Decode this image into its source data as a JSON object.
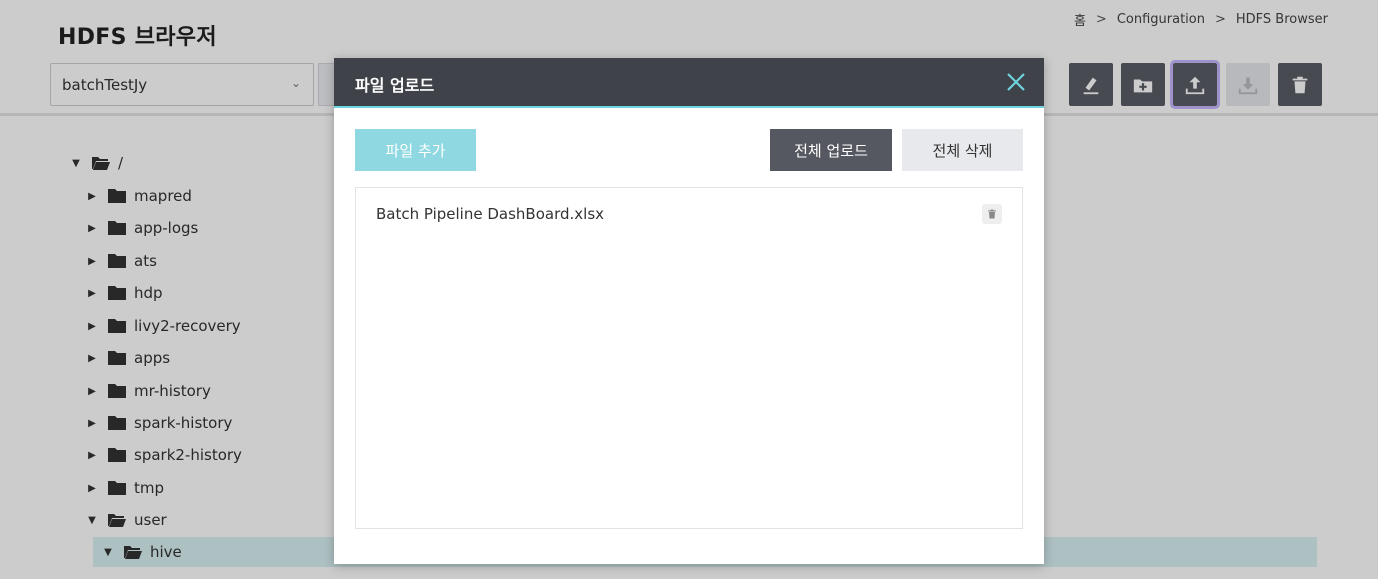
{
  "header": {
    "title": "HDFS 브라우저",
    "breadcrumb": [
      "홈",
      "Configuration",
      "HDFS Browser"
    ],
    "breadcrumb_separator": ">"
  },
  "toolbar": {
    "select_value": "batchTestJy",
    "buttons": [
      {
        "icon": "rename-icon",
        "enabled": true
      },
      {
        "icon": "new-folder-icon",
        "enabled": true
      },
      {
        "icon": "upload-icon",
        "enabled": true,
        "focused": true
      },
      {
        "icon": "download-icon",
        "enabled": false
      },
      {
        "icon": "trash-icon",
        "enabled": true
      }
    ]
  },
  "tree": {
    "root": "/",
    "items": [
      {
        "label": "mapred",
        "expanded": false
      },
      {
        "label": "app-logs",
        "expanded": false
      },
      {
        "label": "ats",
        "expanded": false
      },
      {
        "label": "hdp",
        "expanded": false
      },
      {
        "label": "livy2-recovery",
        "expanded": false
      },
      {
        "label": "apps",
        "expanded": false
      },
      {
        "label": "mr-history",
        "expanded": false
      },
      {
        "label": "spark-history",
        "expanded": false
      },
      {
        "label": "spark2-history",
        "expanded": false
      },
      {
        "label": "tmp",
        "expanded": false
      },
      {
        "label": "user",
        "expanded": true
      }
    ],
    "child": {
      "label": "hive",
      "expanded": true,
      "selected": true
    }
  },
  "modal": {
    "title": "파일 업로드",
    "add_button": "파일 추가",
    "upload_all_button": "전체 업로드",
    "delete_all_button": "전체 삭제",
    "files": [
      {
        "name": "Batch Pipeline DashBoard.xlsx"
      }
    ]
  },
  "colors": {
    "modal_header": "#3f4248",
    "accent": "#8fd8e1",
    "accent_line": "#6fd3df",
    "dark_button": "#555861",
    "focus_ring": "#c6b6ff",
    "selected_row": "#d9f0f3"
  }
}
